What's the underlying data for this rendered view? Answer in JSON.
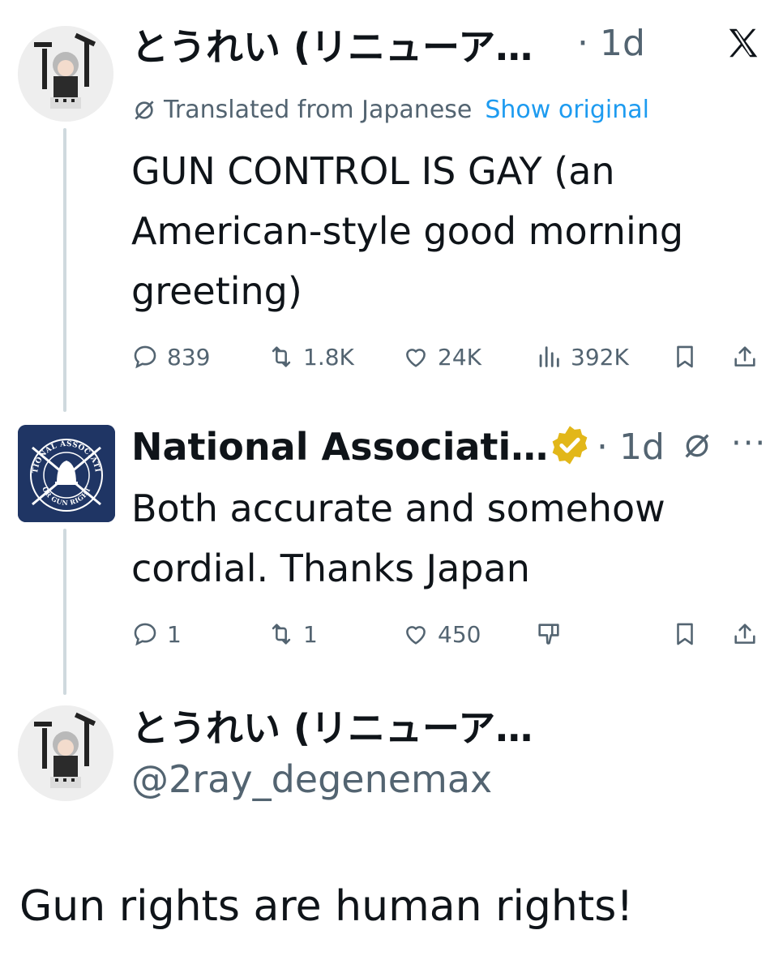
{
  "tweet1": {
    "author_name": "とうれい (リニューア…",
    "time": "· 1d",
    "translated_label": "Translated from Japanese",
    "show_original": "Show original",
    "text_lines": [
      "GUN CONTROL IS GAY (an",
      "American-style good morning",
      "greeting)"
    ],
    "stats": {
      "replies": "839",
      "reposts": "1.8K",
      "likes": "24K",
      "views": "392K"
    }
  },
  "tweet2": {
    "author_name": "National Associati…",
    "time": "· 1d",
    "more": "···",
    "text_lines": [
      "Both accurate and somehow",
      "cordial. Thanks Japan"
    ],
    "stats": {
      "replies": "1",
      "reposts": "1",
      "likes": "450"
    },
    "logo_text": {
      "top": "NATIONAL ASSOCIATION",
      "bottom": "FOR GUN RIGHTS"
    }
  },
  "profile": {
    "author_name": "とうれい (リニューア…",
    "handle": "@2ray_degenemax"
  },
  "caption": "Gun rights are human rights!",
  "icons": {
    "platform": "x-logo-icon",
    "verified": "verified-badge-icon",
    "translate": "globe-slash-icon"
  },
  "colors": {
    "text": "#0f1419",
    "secondary": "#536471",
    "link": "#1d9bf0",
    "verified_gold": "#e2b719",
    "logo_bg": "#1f3564",
    "thread_line": "#cfd9de"
  }
}
